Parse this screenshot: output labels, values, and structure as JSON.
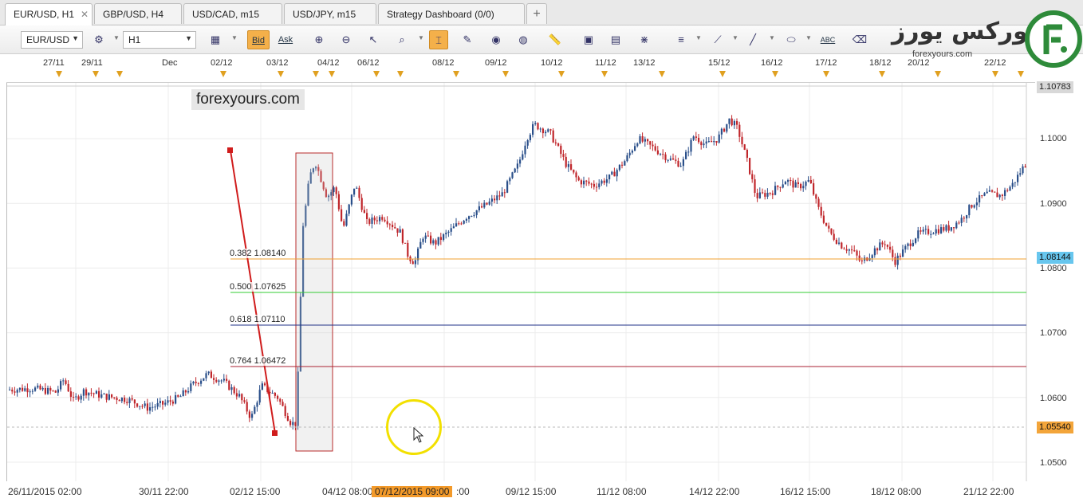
{
  "tabs": [
    {
      "label": "EUR/USD, H1",
      "active": true,
      "close": "✕"
    },
    {
      "label": "GBP/USD, H4"
    },
    {
      "label": "USD/CAD, m15"
    },
    {
      "label": "USD/JPY, m15"
    },
    {
      "label": "Strategy Dashboard (0/0)"
    },
    {
      "label": "+"
    }
  ],
  "toolbar": {
    "symbol": "EUR/USD",
    "timeframe": "H1",
    "bid": "Bid",
    "ask": "Ask",
    "abc": "ABC"
  },
  "logo": {
    "arabic": "فورکس یورز",
    "sub": "forexyours.com"
  },
  "watermark": "forexyours.com",
  "top_dates": [
    "27/11",
    "29/11",
    "Dec",
    "02/12",
    "03/12",
    "04/12",
    "06/12",
    "08/12",
    "09/12",
    "10/12",
    "11/12",
    "13/12",
    "15/12",
    "16/12",
    "17/12",
    "18/12",
    "20/12",
    "22/12"
  ],
  "bottom_dates": [
    "26/11/2015 02:00",
    "30/11 22:00",
    "02/12 15:00",
    "04/12 08:00",
    ":00",
    "09/12 15:00",
    "11/12 08:00",
    "14/12 22:00",
    "16/12 15:00",
    "18/12 08:00",
    "21/12 22:00"
  ],
  "crosshair_date": "07/12/2015 09:00",
  "price_axis": [
    "1.1000",
    "1.0900",
    "1.0800",
    "1.0700",
    "1.0600",
    "1.0500"
  ],
  "price_tags": {
    "top": "1.10783",
    "fib": "1.08144",
    "current": "1.05540"
  },
  "fib_levels": [
    {
      "ratio": "0.382",
      "price": "1.08140",
      "color": "#f0a030"
    },
    {
      "ratio": "0.500",
      "price": "1.07625",
      "color": "#33cc33"
    },
    {
      "ratio": "0.618",
      "price": "1.07110",
      "color": "#223388"
    },
    {
      "ratio": "0.764",
      "price": "1.06472",
      "color": "#aa2233"
    }
  ],
  "colors": {
    "bull": "#2a4f8a",
    "bear": "#c0262b",
    "trend": "#d01c1c",
    "accent": "#f39a2a"
  }
}
